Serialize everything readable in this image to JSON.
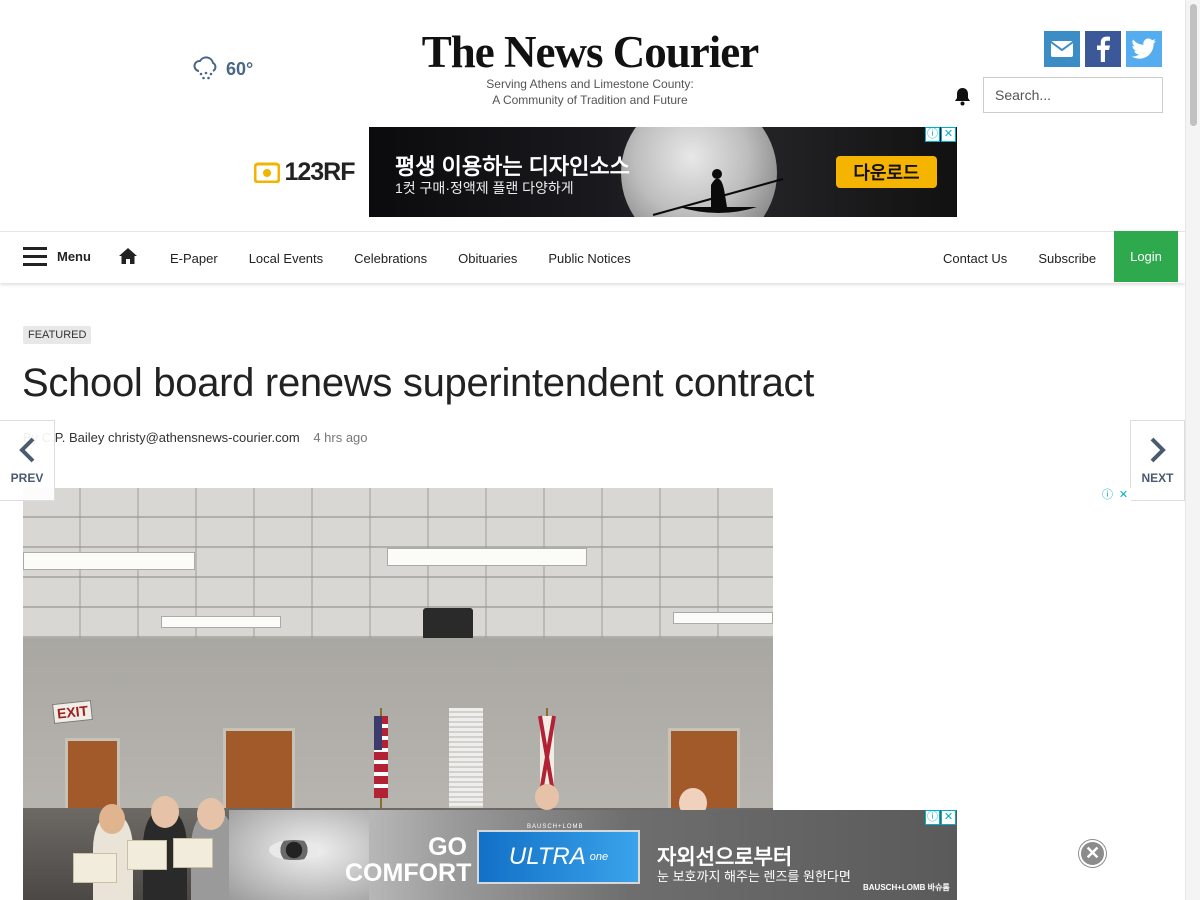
{
  "weather": {
    "temp": "60°",
    "icon": "snow-cloud-icon"
  },
  "masthead": {
    "logo": "The News Courier",
    "tagline1": "Serving Athens and Limestone County:",
    "tagline2": "A Community of Tradition and Future"
  },
  "social": [
    "email-icon",
    "facebook-icon",
    "twitter-icon"
  ],
  "search": {
    "placeholder": "Search..."
  },
  "ads": {
    "top": {
      "brand": "123RF",
      "headline": "평생 이용하는 디자인소스",
      "sub": "1컷 구매·정액제 플랜 다양하게",
      "cta": "다운로드"
    },
    "bottom": {
      "go": "GO",
      "comfort": "COMFORT",
      "product_small": "BAUSCH+LOMB",
      "product": "ULTRA",
      "product_suffix": "one",
      "kr_headline": "자외선으로부터",
      "kr_sub": "눈 보호까지 해주는 렌즈를 원한다면",
      "maker": "BAUSCH+LOMB 바슈롬"
    },
    "adchoice_info": "ⓘ",
    "adchoice_close": "✕"
  },
  "nav": {
    "menu_label": "Menu",
    "links": [
      "E-Paper",
      "Local Events",
      "Celebrations",
      "Obituaries",
      "Public Notices"
    ],
    "right_links": [
      "Contact Us",
      "Subscribe"
    ],
    "login": "Login"
  },
  "article": {
    "badge": "FEATURED",
    "title": "School board renews superintendent contract",
    "byline": "By C.P. Bailey christy@athensnews-courier.com",
    "time": "4 hrs ago"
  },
  "pager": {
    "prev": "PREV",
    "next": "NEXT"
  },
  "photo": {
    "exit_sign": "EXIT"
  },
  "colors": {
    "login_green": "#2ea94d",
    "email_blue": "#3c8dc5",
    "facebook_blue": "#3b5998",
    "twitter_blue": "#55acee",
    "adchoice_cyan": "#00aecd"
  }
}
